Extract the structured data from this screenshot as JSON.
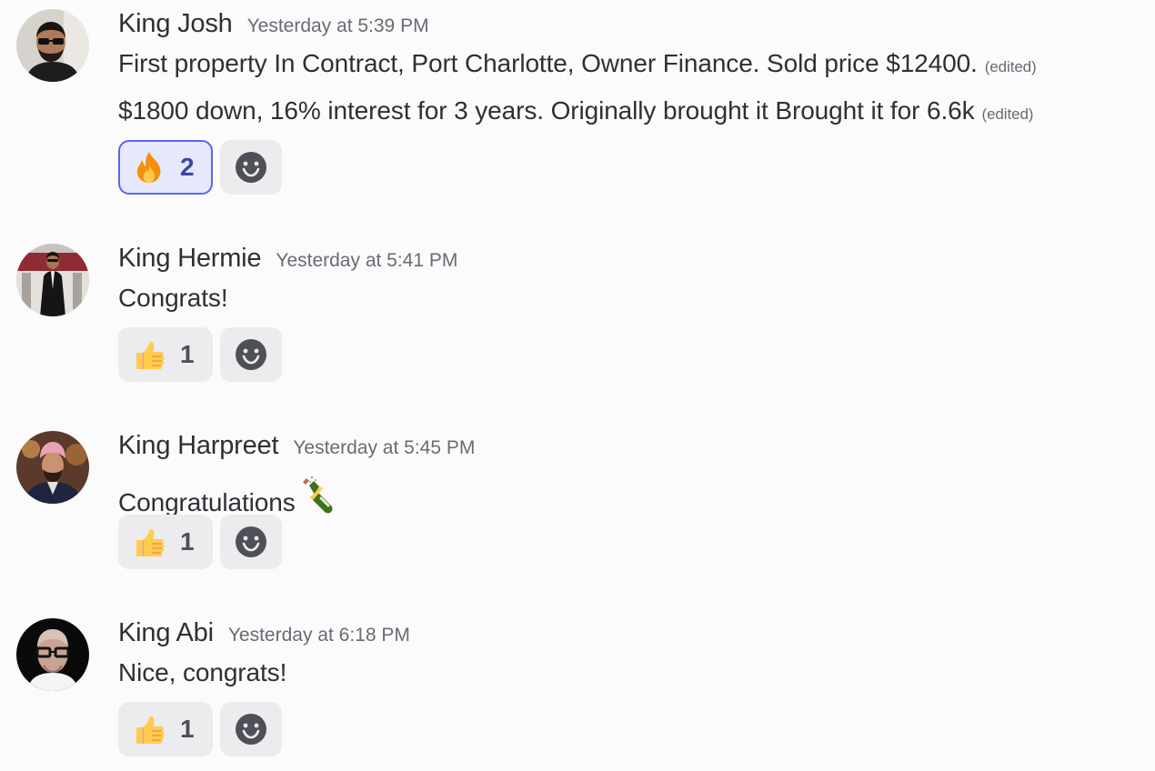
{
  "messages": [
    {
      "username": "King Josh",
      "timestamp": "Yesterday at 5:39 PM",
      "lines": [
        {
          "text": "First property In Contract, Port Charlotte, Owner Finance. Sold price $12400.",
          "edited": "(edited)"
        },
        {
          "text": "$1800 down, 16% interest for 3 years. Originally brought it  Brought it for 6.6k",
          "edited": "(edited)"
        }
      ],
      "reaction": {
        "emoji": "fire-emoji",
        "count": "2",
        "active": true
      }
    },
    {
      "username": "King Hermie",
      "timestamp": "Yesterday at 5:41 PM",
      "lines": [
        {
          "text": "Congrats!"
        }
      ],
      "reaction": {
        "emoji": "thumbs-up-emoji",
        "count": "1",
        "active": false
      }
    },
    {
      "username": "King Harpreet",
      "timestamp": "Yesterday at 5:45 PM",
      "lines": [
        {
          "text": "Congratulations",
          "inline_emoji": "champagne-emoji"
        }
      ],
      "reaction": {
        "emoji": "thumbs-up-emoji",
        "count": "1",
        "active": false
      }
    },
    {
      "username": "King Abi",
      "timestamp": "Yesterday at 6:18 PM",
      "lines": [
        {
          "text": "Nice, congrats!"
        }
      ],
      "reaction": {
        "emoji": "thumbs-up-emoji",
        "count": "1",
        "active": false
      }
    }
  ],
  "colors": {
    "background": "#fbfbfb",
    "text": "#2e3035",
    "muted": "#686b75",
    "reaction_bg": "#ececee",
    "reaction_active_bg": "#e6e8fc",
    "reaction_active_border": "#5865f2"
  }
}
